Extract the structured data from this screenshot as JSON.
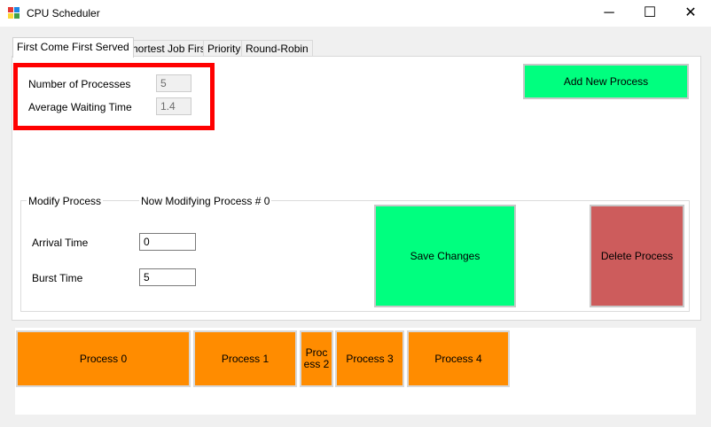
{
  "window": {
    "title": "CPU Scheduler",
    "controls": {
      "minimize": "─",
      "maximize": "☐",
      "close": "✕"
    }
  },
  "tabs": [
    {
      "label": "First Come First Served",
      "active": true
    },
    {
      "label": "Shortest Job First",
      "active": false
    },
    {
      "label": "Priority",
      "active": false
    },
    {
      "label": "Round-Robin",
      "active": false
    }
  ],
  "stats": {
    "num_processes_label": "Number of Processes",
    "num_processes_value": "5",
    "avg_wait_label": "Average Waiting Time",
    "avg_wait_value": "1.4"
  },
  "buttons": {
    "add_new_process": "Add New Process",
    "save_changes": "Save Changes",
    "delete_process": "Delete Process"
  },
  "modify": {
    "group_label": "Modify Process",
    "status": "Now Modifying Process # 0",
    "arrival_label": "Arrival Time",
    "arrival_value": "0",
    "burst_label": "Burst Time",
    "burst_value": "5"
  },
  "processes": [
    {
      "label": "Process 0"
    },
    {
      "label": "Process 1"
    },
    {
      "label": "Proc\ness 2"
    },
    {
      "label": "Process 3"
    },
    {
      "label": "Process 4"
    }
  ],
  "colors": {
    "highlight": "#ff0000",
    "green_button": "#00ff7f",
    "red_button": "#cd5c5c",
    "process_block": "#ff8c00"
  }
}
